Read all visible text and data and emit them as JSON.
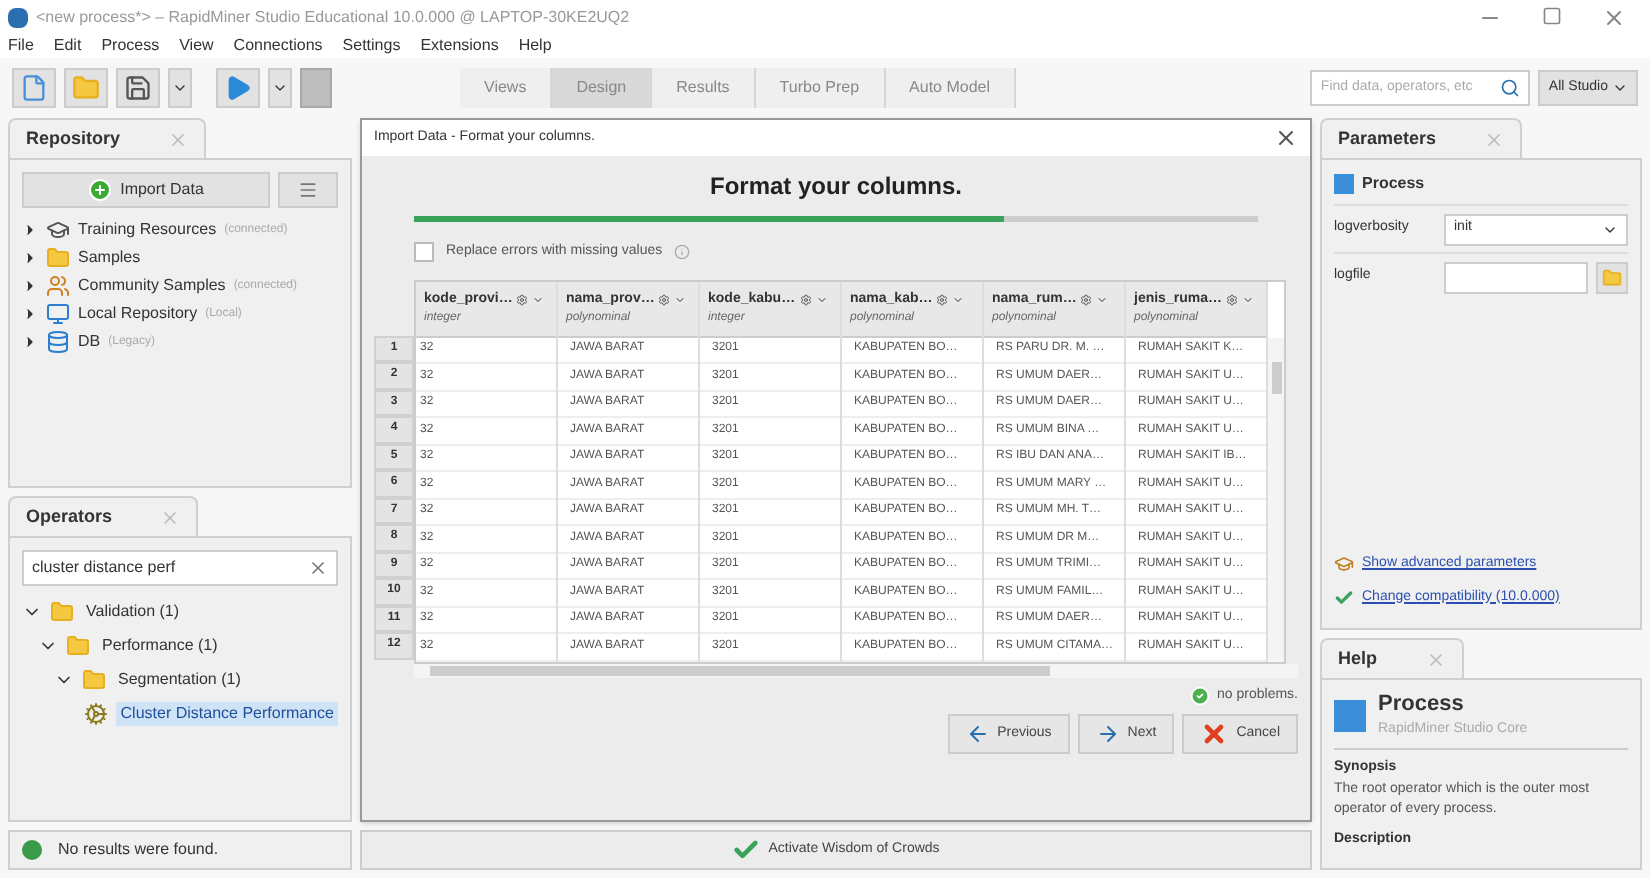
{
  "window": {
    "title": "<new process*> – RapidMiner Studio Educational 10.0.000 @ LAPTOP-30KE2UQ2"
  },
  "menu": [
    "File",
    "Edit",
    "Process",
    "View",
    "Connections",
    "Settings",
    "Extensions",
    "Help"
  ],
  "toolbar": {
    "perspectives": [
      {
        "label": "Views",
        "selected": false
      },
      {
        "label": "Design",
        "selected": true
      },
      {
        "label": "Results",
        "selected": false
      },
      {
        "label": "Turbo Prep",
        "selected": false
      },
      {
        "label": "Auto Model",
        "selected": false
      }
    ],
    "search": {
      "placeholder": "Find data, operators, etc"
    },
    "scope": "All Studio"
  },
  "repository": {
    "title": "Repository",
    "import_button": "Import Data",
    "items": [
      {
        "label": "Training Resources",
        "note": "(connected)",
        "kind": "training"
      },
      {
        "label": "Samples",
        "kind": "folder"
      },
      {
        "label": "Community Samples",
        "note": "(connected)",
        "kind": "community"
      },
      {
        "label": "Local Repository",
        "note": "(Local)",
        "kind": "local"
      },
      {
        "label": "DB",
        "note": "(Legacy)",
        "kind": "db"
      }
    ]
  },
  "operators": {
    "title": "Operators",
    "search": {
      "value": "cluster distance perf"
    },
    "tree": [
      {
        "label": "Validation (1)",
        "kind": "folder",
        "expanded": true,
        "selected": false,
        "children": [
          {
            "label": "Performance (1)",
            "kind": "folder",
            "expanded": true,
            "selected": false,
            "children": [
              {
                "label": "Segmentation (1)",
                "kind": "folder",
                "expanded": true,
                "selected": false,
                "children": [
                  {
                    "label": "Cluster Distance Performance",
                    "kind": "operator",
                    "selected": true
                  }
                ]
              }
            ]
          }
        ]
      }
    ],
    "status": "No results were found."
  },
  "dialog": {
    "title": "Import Data - Format your columns.",
    "heading": "Format your columns.",
    "progress": {
      "level": 0.7
    },
    "replace_errors": {
      "label": "Replace errors with missing values",
      "checked": false
    },
    "columns": [
      {
        "name": "kode_provi…",
        "type": "integer"
      },
      {
        "name": "nama_prov…",
        "type": "polynominal"
      },
      {
        "name": "kode_kabu…",
        "type": "integer"
      },
      {
        "name": "nama_kab…",
        "type": "polynominal"
      },
      {
        "name": "nama_rum…",
        "type": "polynominal"
      },
      {
        "name": "jenis_ruma…",
        "type": "polynominal"
      }
    ],
    "rows": [
      {
        "number": "1",
        "cells": [
          "32",
          "JAWA BARAT",
          "3201",
          "KABUPATEN BO…",
          "RS PARU DR. M. …",
          "RUMAH SAKIT K…"
        ]
      },
      {
        "number": "2",
        "cells": [
          "32",
          "JAWA BARAT",
          "3201",
          "KABUPATEN BO…",
          "RS UMUM DAER…",
          "RUMAH SAKIT U…"
        ]
      },
      {
        "number": "3",
        "cells": [
          "32",
          "JAWA BARAT",
          "3201",
          "KABUPATEN BO…",
          "RS UMUM DAER…",
          "RUMAH SAKIT U…"
        ]
      },
      {
        "number": "4",
        "cells": [
          "32",
          "JAWA BARAT",
          "3201",
          "KABUPATEN BO…",
          "RS UMUM BINA …",
          "RUMAH SAKIT U…"
        ]
      },
      {
        "number": "5",
        "cells": [
          "32",
          "JAWA BARAT",
          "3201",
          "KABUPATEN BO…",
          "RS IBU DAN ANA…",
          "RUMAH SAKIT IB…"
        ]
      },
      {
        "number": "6",
        "cells": [
          "32",
          "JAWA BARAT",
          "3201",
          "KABUPATEN BO…",
          "RS UMUM MARY …",
          "RUMAH SAKIT U…"
        ]
      },
      {
        "number": "7",
        "cells": [
          "32",
          "JAWA BARAT",
          "3201",
          "KABUPATEN BO…",
          "RS UMUM MH. T…",
          "RUMAH SAKIT U…"
        ]
      },
      {
        "number": "8",
        "cells": [
          "32",
          "JAWA BARAT",
          "3201",
          "KABUPATEN BO…",
          "RS UMUM DR M…",
          "RUMAH SAKIT U…"
        ]
      },
      {
        "number": "9",
        "cells": [
          "32",
          "JAWA BARAT",
          "3201",
          "KABUPATEN BO…",
          "RS UMUM TRIMI…",
          "RUMAH SAKIT U…"
        ]
      },
      {
        "number": "10",
        "cells": [
          "32",
          "JAWA BARAT",
          "3201",
          "KABUPATEN BO…",
          "RS UMUM FAMIL…",
          "RUMAH SAKIT U…"
        ]
      },
      {
        "number": "11",
        "cells": [
          "32",
          "JAWA BARAT",
          "3201",
          "KABUPATEN BO…",
          "RS UMUM DAER…",
          "RUMAH SAKIT U…"
        ]
      },
      {
        "number": "12",
        "cells": [
          "32",
          "JAWA BARAT",
          "3201",
          "KABUPATEN BO…",
          "RS UMUM CITAMA…",
          "RUMAH SAKIT U…"
        ]
      }
    ],
    "status": "no problems.",
    "buttons": [
      {
        "label": "Previous",
        "kind": "previous"
      },
      {
        "label": "Next",
        "kind": "next"
      },
      {
        "label": "Cancel",
        "kind": "cancel"
      }
    ]
  },
  "wisdom_button": "Activate Wisdom of Crowds",
  "parameters": {
    "title": "Parameters",
    "operator": "Process",
    "fields": [
      {
        "label": "logverbosity",
        "kind": "select",
        "value": "init"
      },
      {
        "label": "logfile",
        "kind": "file"
      }
    ],
    "links": [
      {
        "label": "Show advanced parameters",
        "kind": "advanced"
      },
      {
        "label": "Change compatibility (10.0.000)",
        "kind": "compat"
      }
    ]
  },
  "help": {
    "title": "Help",
    "operator": "Process",
    "source": "RapidMiner Studio Core",
    "synopsis_title": "Synopsis",
    "synopsis": "The root operator which is the outer most operator of every process.",
    "description_title": "Description"
  }
}
